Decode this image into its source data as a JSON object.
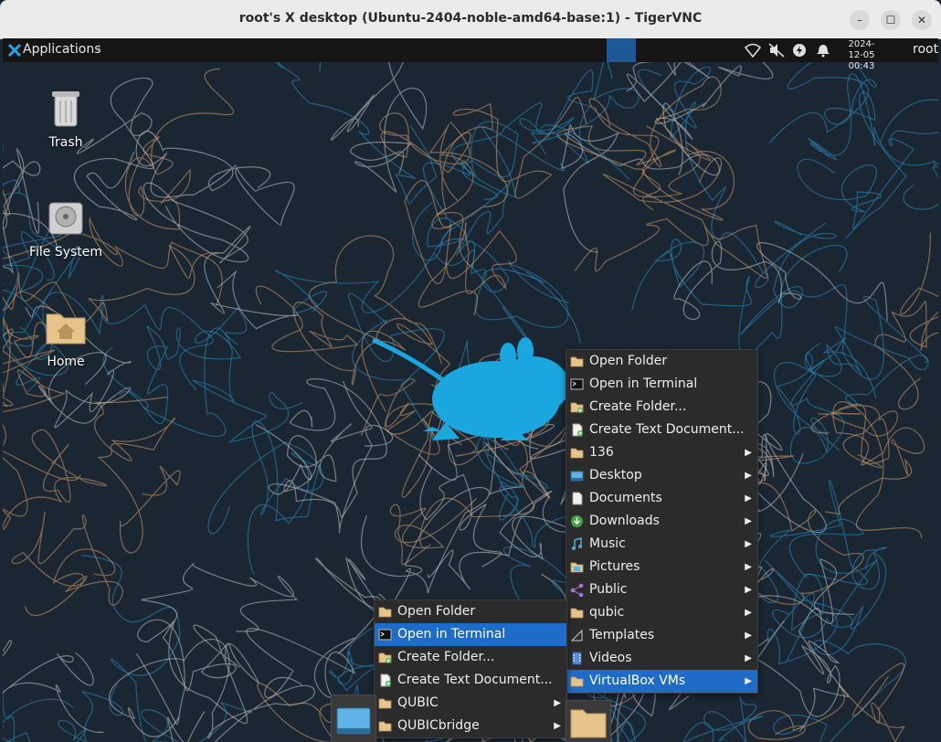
{
  "window": {
    "title": "root's X desktop (Ubuntu-2404-noble-amd64-base:1) - TigerVNC",
    "minimize_glyph": "–",
    "maximize_glyph": "☐",
    "close_glyph": "✕"
  },
  "panel": {
    "apps_label": "Applications",
    "apps_suffix": "⠇",
    "date": "2024-12-05",
    "time": "00:43",
    "user": "root",
    "icons": [
      "network-wireless-icon",
      "speaker-muted-icon",
      "power-icon",
      "notification-bell-icon"
    ]
  },
  "desktop_icons": [
    {
      "label": "Trash",
      "icon": "trash-icon"
    },
    {
      "label": "File System",
      "icon": "hard-drive-icon"
    },
    {
      "label": "Home",
      "icon": "home-folder-icon"
    }
  ],
  "menu_right": {
    "items": [
      {
        "label": "Open Folder",
        "icon": "folder-icon",
        "submenu": false
      },
      {
        "label": "Open in Terminal",
        "icon": "terminal-icon",
        "submenu": false
      },
      {
        "label": "Create Folder...",
        "icon": "folder-new-icon",
        "submenu": false
      },
      {
        "label": "Create Text Document...",
        "icon": "document-new-icon",
        "submenu": false
      },
      {
        "label": "136",
        "icon": "folder-icon",
        "submenu": true
      },
      {
        "label": "Desktop",
        "icon": "desktop-icon",
        "submenu": true
      },
      {
        "label": "Documents",
        "icon": "document-icon",
        "submenu": true
      },
      {
        "label": "Downloads",
        "icon": "downloads-icon",
        "submenu": true
      },
      {
        "label": "Music",
        "icon": "music-icon",
        "submenu": true
      },
      {
        "label": "Pictures",
        "icon": "pictures-icon",
        "submenu": true
      },
      {
        "label": "Public",
        "icon": "share-icon",
        "submenu": true
      },
      {
        "label": "qubic",
        "icon": "folder-icon",
        "submenu": true
      },
      {
        "label": "Templates",
        "icon": "templates-icon",
        "submenu": true
      },
      {
        "label": "Videos",
        "icon": "videos-icon",
        "submenu": true
      },
      {
        "label": "VirtualBox VMs",
        "icon": "folder-icon",
        "submenu": true,
        "highlighted": true
      }
    ]
  },
  "menu_left": {
    "items": [
      {
        "label": "Open Folder",
        "icon": "folder-icon",
        "submenu": false
      },
      {
        "label": "Open in Terminal",
        "icon": "terminal-icon",
        "submenu": false,
        "highlighted": true
      },
      {
        "label": "Create Folder...",
        "icon": "folder-new-icon",
        "submenu": false
      },
      {
        "label": "Create Text Document...",
        "icon": "document-new-icon",
        "submenu": false
      },
      {
        "label": "QUBIC",
        "icon": "folder-icon",
        "submenu": true
      },
      {
        "label": "QUBICbridge",
        "icon": "folder-icon",
        "submenu": true
      }
    ]
  },
  "submenu_arrow": "▶",
  "colors": {
    "panel_bg": "#151515",
    "menu_bg": "#2b2b2b",
    "highlight": "#1f6cc8",
    "mouse_logo": "#1aa7e0",
    "wallpaper_bg": "#1b2633",
    "line_orange": "#d8a06a",
    "line_white": "#c9c9c9",
    "line_blue": "#2a8fc4"
  }
}
